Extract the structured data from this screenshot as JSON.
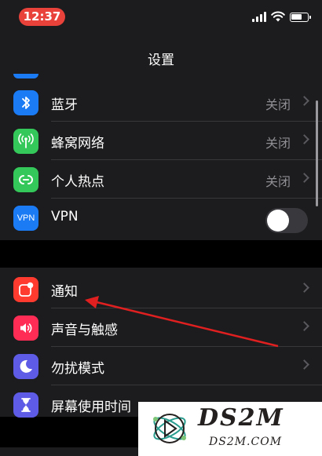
{
  "status_bar": {
    "time": "12:37",
    "battery_level": 0.7
  },
  "nav": {
    "title": "设置"
  },
  "group1": [
    {
      "label": "蓝牙",
      "value": "关闭",
      "icon": "bluetooth-icon",
      "color": "#1a7bf5"
    },
    {
      "label": "蜂窝网络",
      "value": "关闭",
      "icon": "cellular-antenna-icon",
      "color": "#34c759"
    },
    {
      "label": "个人热点",
      "value": "关闭",
      "icon": "personal-hotspot-icon",
      "color": "#34c759"
    },
    {
      "label": "VPN",
      "icon_text": "VPN",
      "toggle_on": false,
      "icon": "vpn-icon",
      "color": "#1a7bf5"
    }
  ],
  "group2": [
    {
      "label": "通知",
      "icon": "notifications-icon",
      "color": "#ff3b30"
    },
    {
      "label": "声音与触感",
      "icon": "speaker-icon",
      "color": "#ff2d55"
    },
    {
      "label": "勿扰模式",
      "icon": "moon-icon",
      "color": "#5e5ce6"
    },
    {
      "label": "屏幕使用时间",
      "icon": "hourglass-icon",
      "color": "#5e5ce6"
    }
  ],
  "watermark": {
    "brand": "DS2M",
    "site": "DS2M.COM"
  },
  "annotation": {
    "color": "#e02020"
  }
}
